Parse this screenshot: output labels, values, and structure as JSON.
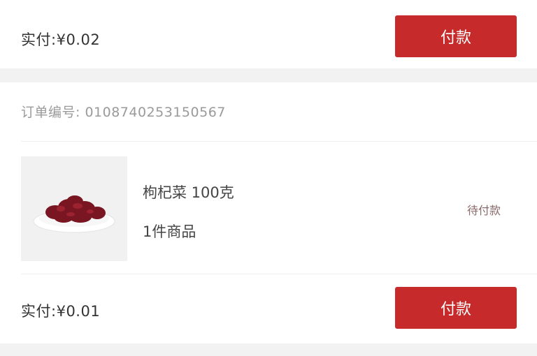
{
  "orders": [
    {
      "paid_label": "实付:",
      "paid_amount": "¥0.02",
      "pay_button": "付款"
    },
    {
      "order_no_label": "订单编号:",
      "order_no": "0108740253150567",
      "product_name": "枸杞菜 100克",
      "quantity_text": "1件商品",
      "status": "待付款",
      "paid_label": "实付:",
      "paid_amount": "¥0.01",
      "pay_button": "付款"
    }
  ],
  "colors": {
    "accent": "#c62a2a",
    "background": "#f2f2f2",
    "card": "#ffffff"
  },
  "icons": {
    "product_image": "dried-berries-plate"
  }
}
